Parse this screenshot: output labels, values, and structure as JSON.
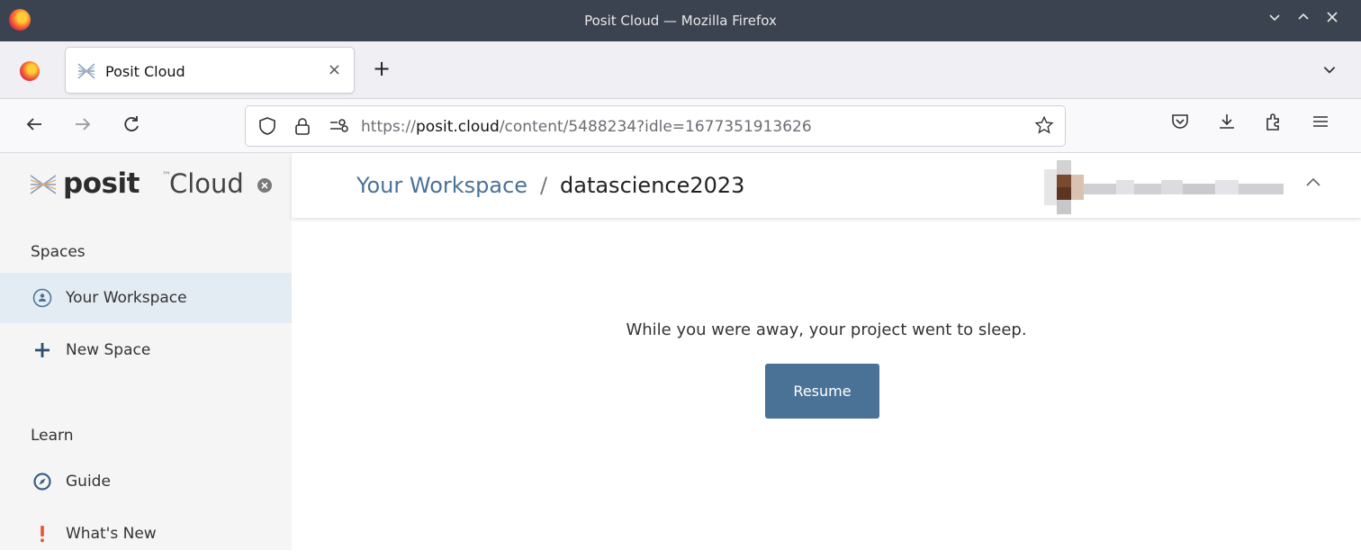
{
  "window": {
    "title": "Posit Cloud — Mozilla Firefox",
    "controls": [
      "chevron-down-icon",
      "chevron-up-icon",
      "close-icon"
    ]
  },
  "tabs": [
    {
      "title": "Posit Cloud",
      "icon": "posit-favicon-icon",
      "close": "×"
    }
  ],
  "toolbar": {
    "new_tab": "+",
    "url_prefix": "https://",
    "url_host": "posit.cloud",
    "url_path": "/content/5488234?idle=1677351913626",
    "icons": [
      "back-icon",
      "forward-icon",
      "reload-icon",
      "shield-icon",
      "lock-icon",
      "permissions-icon",
      "bookmark-star-icon",
      "pocket-icon",
      "download-icon",
      "extensions-icon",
      "menu-icon"
    ]
  },
  "sidebar": {
    "brand_posit": "posit",
    "brand_tm": "™",
    "brand_cloud": "Cloud",
    "spaces_heading": "Spaces",
    "spaces_items": [
      {
        "label": "Your Workspace",
        "icon": "user-circle-icon",
        "active": true
      },
      {
        "label": "New Space",
        "icon": "plus-icon",
        "active": false
      }
    ],
    "learn_heading": "Learn",
    "learn_items": [
      {
        "label": "Guide",
        "icon": "compass-icon"
      },
      {
        "label": "What's New",
        "icon": "exclamation-icon"
      }
    ]
  },
  "header": {
    "breadcrumb_link": "Your Workspace",
    "breadcrumb_sep": "/",
    "breadcrumb_current": "datascience2023"
  },
  "main": {
    "message": "While you were away, your project went to sleep.",
    "resume_label": "Resume"
  },
  "colors": {
    "accent": "#4a7297",
    "titlebar": "#3b4250",
    "sidebar_bg": "#f5f5f5",
    "sidebar_active": "#e3ebf3"
  }
}
